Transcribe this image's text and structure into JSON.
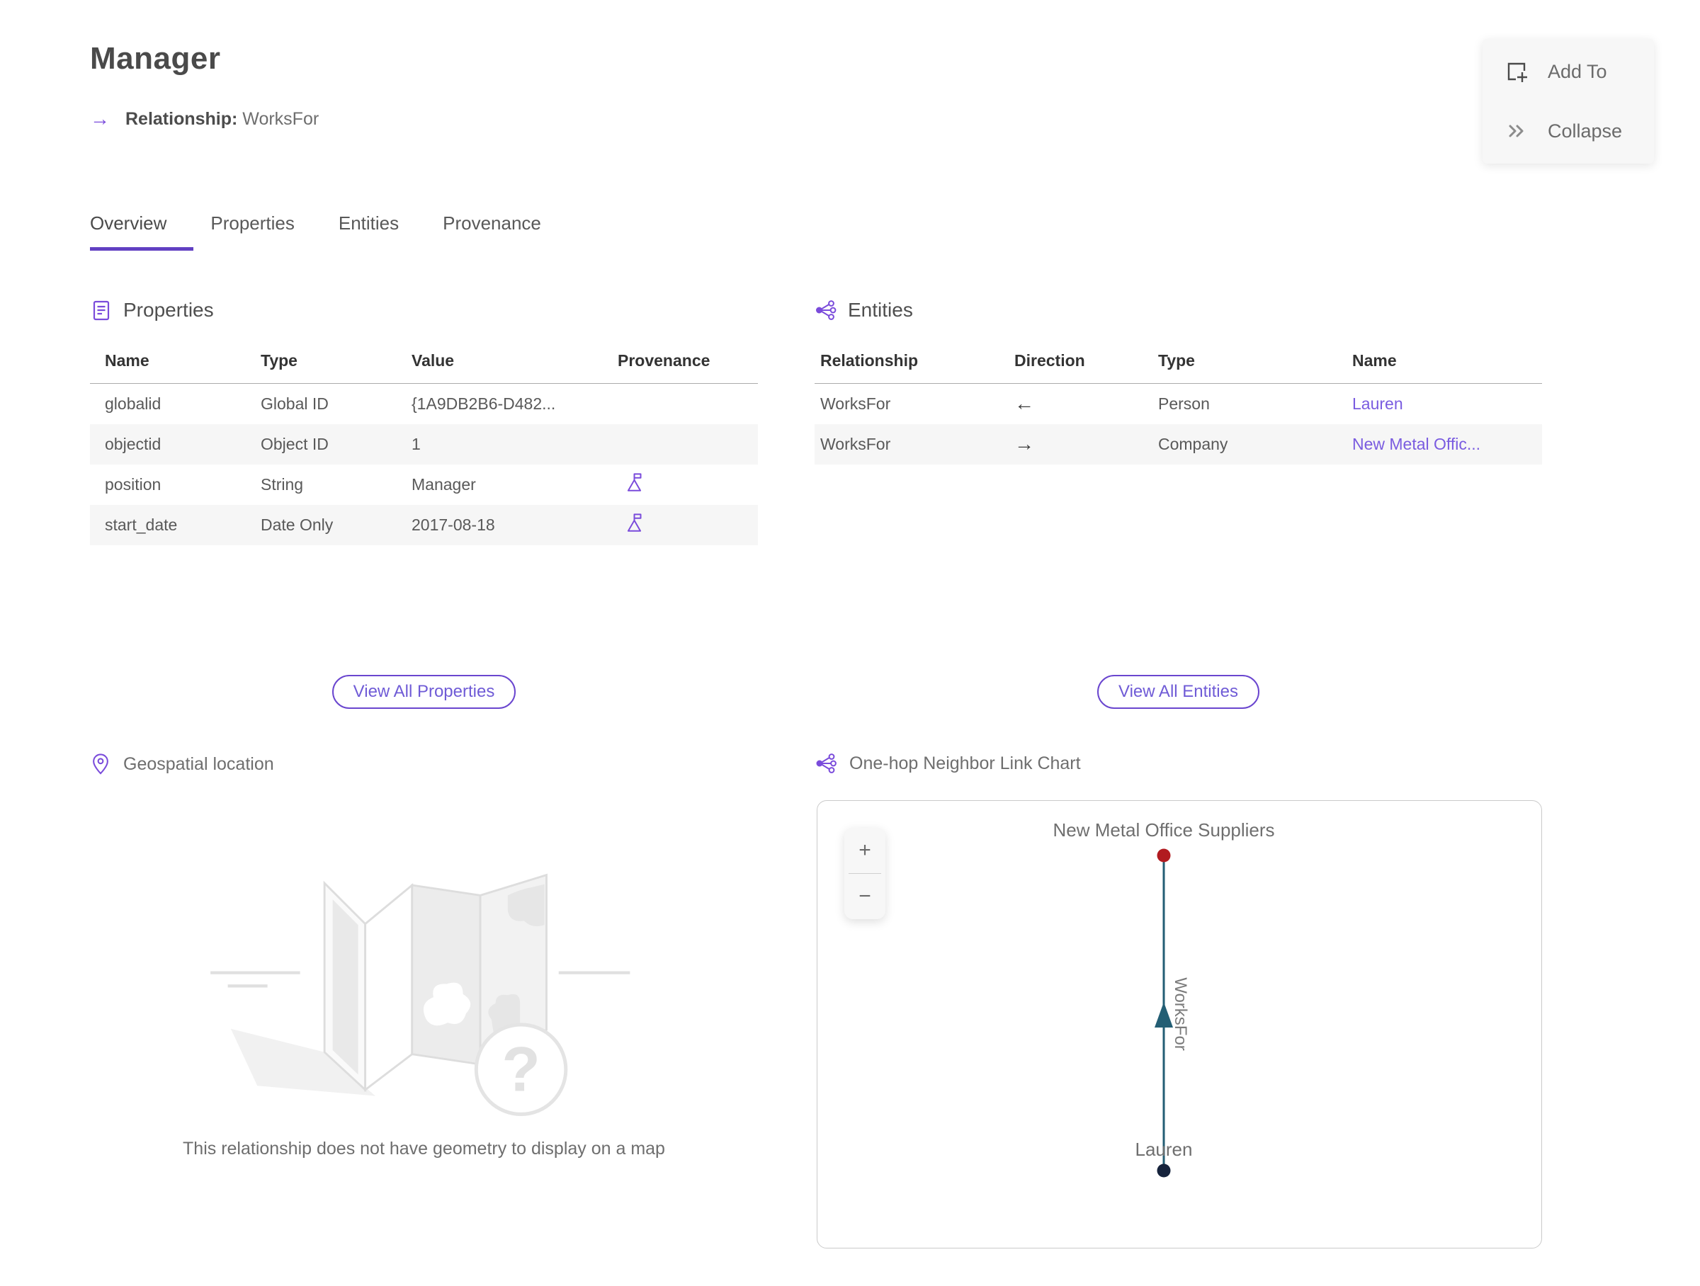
{
  "page": {
    "title": "Manager",
    "subtitle_label": "Relationship:",
    "subtitle_value": "WorksFor",
    "subtitle_arrow": "→"
  },
  "actions": {
    "add_to": "Add To",
    "collapse": "Collapse"
  },
  "tabs": [
    {
      "label": "Overview",
      "active": true
    },
    {
      "label": "Properties",
      "active": false
    },
    {
      "label": "Entities",
      "active": false
    },
    {
      "label": "Provenance",
      "active": false
    }
  ],
  "properties_panel": {
    "title": "Properties",
    "columns": [
      "Name",
      "Type",
      "Value",
      "Provenance"
    ],
    "rows": [
      {
        "name": "globalid",
        "type": "Global ID",
        "value": "{1A9DB2B6-D482..."
      },
      {
        "name": "objectid",
        "type": "Object ID",
        "value": "1"
      },
      {
        "name": "position",
        "type": "String",
        "value": "Manager"
      },
      {
        "name": "start_date",
        "type": "Date Only",
        "value": "2017-08-18"
      }
    ],
    "view_all_label": "View All Properties"
  },
  "entities_panel": {
    "title": "Entities",
    "columns": [
      "Relationship",
      "Direction",
      "Type",
      "Name"
    ],
    "rows": [
      {
        "relationship": "WorksFor",
        "direction": "←",
        "type": "Person",
        "name": "Lauren"
      },
      {
        "relationship": "WorksFor",
        "direction": "→",
        "type": "Company",
        "name": "New Metal Offic..."
      }
    ],
    "view_all_label": "View All Entities"
  },
  "geospatial": {
    "title": "Geospatial location",
    "empty_message": "This relationship does not have geometry to display on a map"
  },
  "link_chart": {
    "title": "One-hop Neighbor Link Chart",
    "zoom_in": "+",
    "zoom_out": "−",
    "top_node": {
      "label": "New Metal Office Suppliers",
      "color": "#b11b20"
    },
    "bottom_node": {
      "label": "Lauren",
      "color": "#16233c"
    },
    "edge": {
      "label": "WorksFor",
      "color": "#235e74",
      "direction": "up"
    }
  },
  "colors": {
    "accent_purple": "#6140c2",
    "icon_purple": "#7a4bdb",
    "link_purple": "#7a5ce0",
    "edge_teal": "#235e74",
    "node_red": "#b11b20",
    "node_dark": "#16233c",
    "row_stripe": "#f6f6f6"
  }
}
